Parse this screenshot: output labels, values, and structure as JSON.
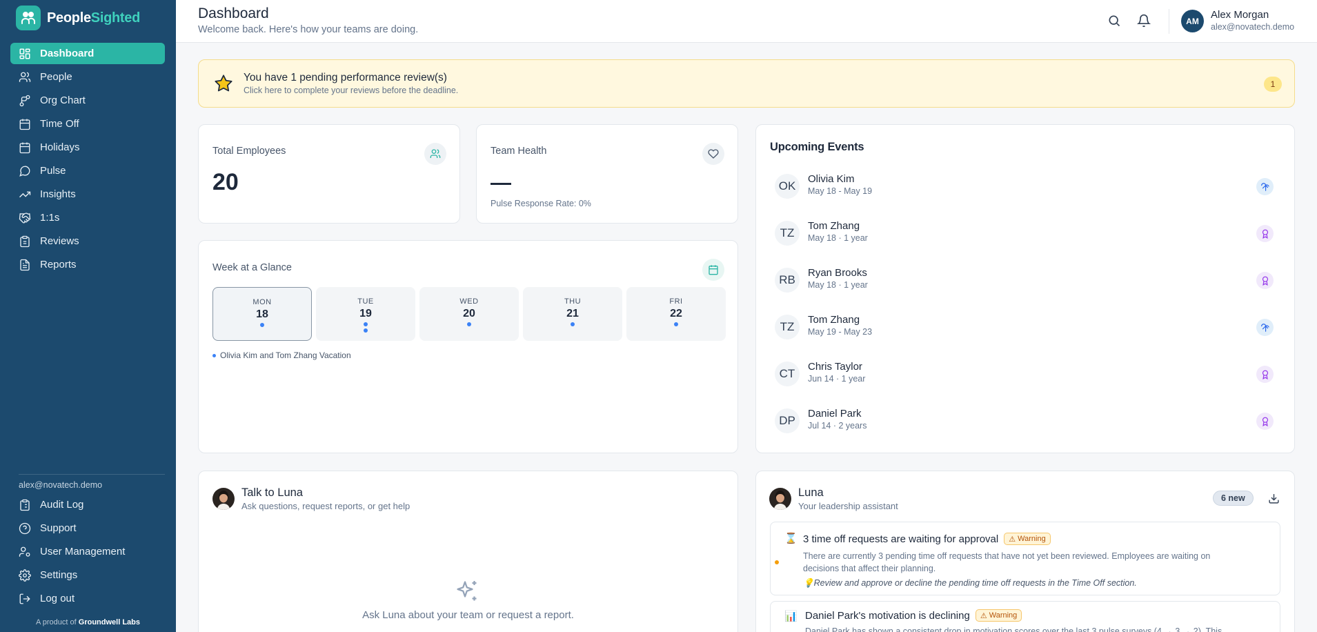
{
  "app": {
    "brand_part1": "People",
    "brand_part2": "Sighted"
  },
  "sidebar": {
    "items": [
      {
        "label": "Dashboard",
        "icon": "dashboard-icon",
        "active": true
      },
      {
        "label": "People",
        "icon": "people-icon"
      },
      {
        "label": "Org Chart",
        "icon": "org-chart-icon"
      },
      {
        "label": "Time Off",
        "icon": "calendar-icon"
      },
      {
        "label": "Holidays",
        "icon": "calendar-days-icon"
      },
      {
        "label": "Pulse",
        "icon": "message-circle-icon"
      },
      {
        "label": "Insights",
        "icon": "trending-up-icon"
      },
      {
        "label": "1:1s",
        "icon": "handshake-icon"
      },
      {
        "label": "Reviews",
        "icon": "clipboard-icon"
      },
      {
        "label": "Reports",
        "icon": "file-text-icon"
      }
    ],
    "email": "alex@novatech.demo",
    "bottom_items": [
      {
        "label": "Audit Log",
        "icon": "clipboard-list-icon"
      },
      {
        "label": "Support",
        "icon": "help-circle-icon"
      },
      {
        "label": "User Management",
        "icon": "user-cog-icon"
      },
      {
        "label": "Settings",
        "icon": "gear-icon"
      },
      {
        "label": "Log out",
        "icon": "logout-icon"
      }
    ],
    "credit_prefix": "A product of",
    "credit_company": "Groundwell Labs"
  },
  "header": {
    "title": "Dashboard",
    "subtitle": "Welcome back. Here's how your teams are doing.",
    "user": {
      "initials": "AM",
      "name": "Alex Morgan",
      "email": "alex@novatech.demo"
    }
  },
  "banner": {
    "title": "You have 1 pending performance review(s)",
    "subtitle": "Click here to complete your reviews before the deadline.",
    "count": "1",
    "colors": {
      "background": "#fff8df",
      "border": "#f4dc8c",
      "star": "#f5c518"
    }
  },
  "stats": {
    "employees": {
      "label": "Total Employees",
      "value": "20"
    },
    "health": {
      "label": "Team Health",
      "pulse_rate": "Pulse Response Rate: 0%"
    }
  },
  "week": {
    "title": "Week at a Glance",
    "days": [
      {
        "name": "MON",
        "num": "18",
        "dots": 1,
        "today": true
      },
      {
        "name": "TUE",
        "num": "19",
        "dots": 2
      },
      {
        "name": "WED",
        "num": "20",
        "dots": 1
      },
      {
        "name": "THU",
        "num": "21",
        "dots": 1
      },
      {
        "name": "FRI",
        "num": "22",
        "dots": 1
      }
    ],
    "note": "Olivia Kim and Tom Zhang Vacation"
  },
  "events": {
    "title": "Upcoming Events",
    "items": [
      {
        "initials": "OK",
        "name": "Olivia Kim",
        "date": "May 18 - May 19",
        "type": "vacation"
      },
      {
        "initials": "TZ",
        "name": "Tom Zhang",
        "date": "May 18 · 1 year",
        "type": "anniversary"
      },
      {
        "initials": "RB",
        "name": "Ryan Brooks",
        "date": "May 18 · 1 year",
        "type": "anniversary"
      },
      {
        "initials": "TZ",
        "name": "Tom Zhang",
        "date": "May 19 - May 23",
        "type": "vacation"
      },
      {
        "initials": "CT",
        "name": "Chris Taylor",
        "date": "Jun 14 · 1 year",
        "type": "anniversary"
      },
      {
        "initials": "DP",
        "name": "Daniel Park",
        "date": "Jul 14 · 2 years",
        "type": "anniversary"
      }
    ]
  },
  "talk": {
    "title": "Talk to Luna",
    "subtitle": "Ask questions, request reports, or get help",
    "prompt": "Ask Luna about your team or request a report."
  },
  "luna": {
    "title": "Luna",
    "subtitle": "Your leadership assistant",
    "badge": "6 new",
    "insights": [
      {
        "icon": "hourglass-icon",
        "emoji": "⌛",
        "title": "3 time off requests are waiting for approval",
        "tag": "Warning",
        "body": "There are currently 3 pending time off requests that have not yet been reviewed. Employees are waiting on decisions that affect their planning.",
        "tip": "Review and approve or decline the pending time off requests in the Time Off section."
      },
      {
        "icon": "bar-chart-icon",
        "emoji": "📊",
        "title": "Daniel Park's motivation is declining",
        "tag": "Warning",
        "body": "Daniel Park has shown a consistent drop in motivation scores over the last 3 pulse surveys (4 → 3 → 2). This"
      }
    ]
  },
  "theme": {
    "sidebar": "#1c4a6e",
    "accent": "#2bb5a5",
    "dot": "#3b82f6",
    "warning": "#b45309"
  }
}
